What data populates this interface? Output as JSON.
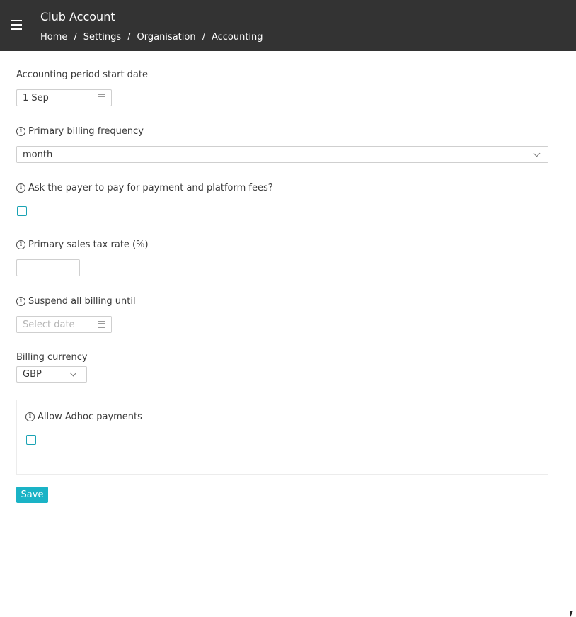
{
  "header": {
    "title": "Club Account",
    "breadcrumb": [
      "Home",
      "Settings",
      "Organisation",
      "Accounting"
    ]
  },
  "form": {
    "period_start": {
      "label": "Accounting period start date",
      "value": "1 Sep"
    },
    "billing_frequency": {
      "label": "Primary billing frequency",
      "value": "month"
    },
    "payer_fees": {
      "label": "Ask the payer to pay for payment and platform fees?",
      "checked": false
    },
    "sales_tax": {
      "label": "Primary sales tax rate (%)",
      "value": ""
    },
    "suspend_billing": {
      "label": "Suspend all billing until",
      "placeholder": "Select date"
    },
    "currency": {
      "label": "Billing currency",
      "value": "GBP"
    },
    "adhoc": {
      "label": "Allow Adhoc payments",
      "checked": false
    },
    "save_label": "Save"
  },
  "colors": {
    "header_bg": "#333333",
    "accent": "#1ab3c6"
  }
}
